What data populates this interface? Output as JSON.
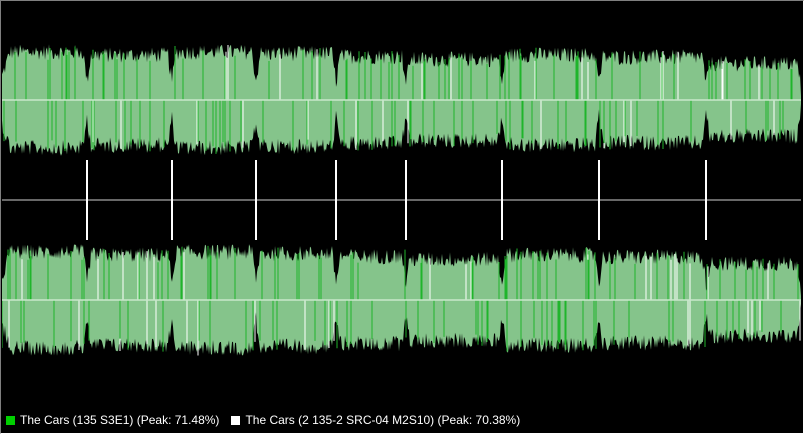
{
  "colors": {
    "background": "#000000",
    "waveform_fill": "#85c48b",
    "waveform_highlight": "#1fb52b",
    "waveform_peak": "#ffffff",
    "center_line": "#c9e8cb",
    "divider": "#8a8a8a",
    "marker": "#ffffff",
    "legend_track1": "#00d000",
    "legend_track2": "#ffffff"
  },
  "legend": {
    "track1": {
      "label": "The Cars (135 S3E1) (Peak: 71.48%)",
      "swatch": "green-swatch"
    },
    "track2": {
      "label": "The Cars (2 135-2 SRC-04 M2S10) (Peak: 70.38%)",
      "swatch": "white-swatch"
    }
  },
  "segment_levels": [
    0.62,
    0.58,
    0.62,
    0.6,
    0.56,
    0.52,
    0.58,
    0.55,
    0.46
  ]
}
